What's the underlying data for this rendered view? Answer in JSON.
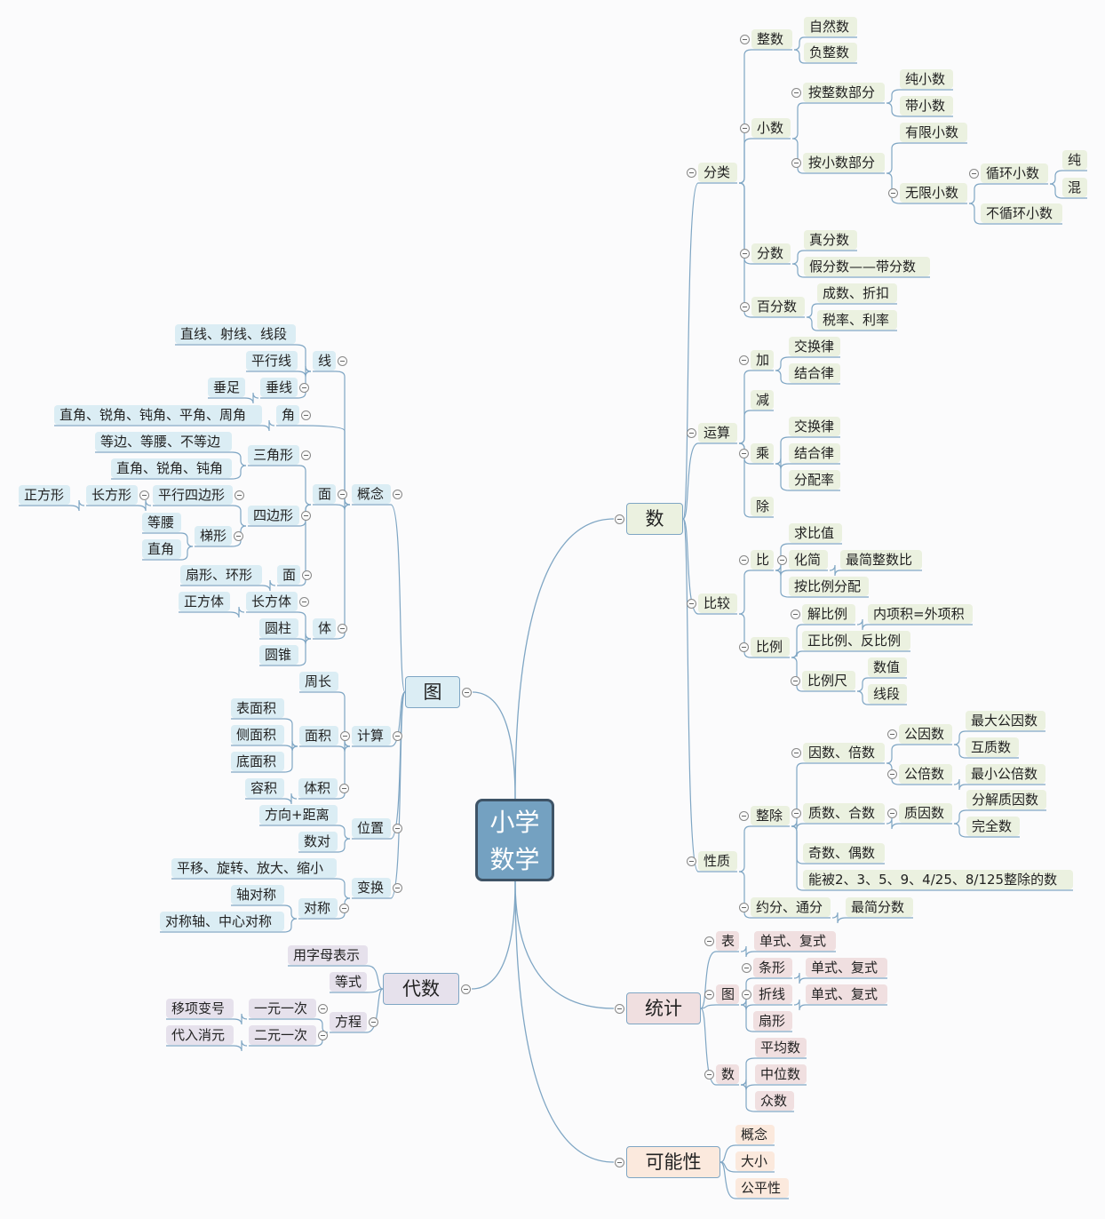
{
  "root": {
    "line1": "小学",
    "line2": "数学"
  },
  "colors": {
    "link": "#7fa6c4",
    "root_fill": "#74a1c1",
    "root_border": "#3e5366",
    "num": "#ebf1e0",
    "fig": "#dbedf4",
    "alg": "#e6e1ec",
    "sta": "#f0dfe0",
    "pro": "#fbe9dd"
  },
  "n": {
    "shu": "数",
    "fenlei": "分类",
    "zhengshu": "整数",
    "ziranshu": "自然数",
    "fuzhengshu": "负整数",
    "xiaoshu": "小数",
    "anzhengshu": "按整数部分",
    "chunxiaoshu": "纯小数",
    "daixiaoshu": "带小数",
    "anxiaoshu": "按小数部分",
    "youxian": "有限小数",
    "wuxian": "无限小数",
    "xunhuan": "循环小数",
    "chun": "纯",
    "hun": "混",
    "buxunhuan": "不循环小数",
    "fenshu": "分数",
    "zhenfenshu": "真分数",
    "jiafenshu": "假分数——带分数",
    "baifenshu": "百分数",
    "chengshu": "成数、折扣",
    "shuilv": "税率、利率",
    "yunsuan": "运算",
    "jia": "加",
    "jia_jh": "交换律",
    "jia_jh2": "结合律",
    "jian": "减",
    "cheng": "乘",
    "cheng_jh": "交换律",
    "cheng_jh2": "结合律",
    "fenpei": "分配率",
    "chu": "除",
    "bijiao": "比较",
    "bi": "比",
    "qiubizhi": "求比值",
    "huajian": "化简",
    "zuijianzhengshubi": "最简整数比",
    "anbili": "按比例分配",
    "bili": "比例",
    "jiebili": "解比例",
    "neixiang": "内项积=外项积",
    "zhengfan": "正比例、反比例",
    "bilichi": "比例尺",
    "shuzhi": "数值",
    "xianduan": "线段",
    "xingzhi": "性质",
    "zhengchu": "整除",
    "yinshu": "因数、倍数",
    "gongyin": "公因数",
    "zuidagongyin": "最大公因数",
    "huzhi": "互质数",
    "gongbei": "公倍数",
    "zuixiaogongbei": "最小公倍数",
    "zhishu": "质数、合数",
    "zhiyinshu": "质因数",
    "fenjie": "分解质因数",
    "wanquan": "完全数",
    "jiou": "奇数、偶数",
    "nengbei": "能被2、3、5、9、4/25、8/125整除的数",
    "yuefen": "约分、通分",
    "zuijianfenshu": "最简分数",
    "tongji": "统计",
    "biao": "表",
    "biao_d": "单式、复式",
    "tu2": "图",
    "tiaoxing": "条形",
    "tiao_d": "单式、复式",
    "zhexian": "折线",
    "zhe_d": "单式、复式",
    "shanxing": "扇形",
    "shu2": "数",
    "pingjun": "平均数",
    "zhongwei": "中位数",
    "zhongshu": "众数",
    "keneng": "可能性",
    "gainian2": "概念",
    "daxiao": "大小",
    "gongping": "公平性",
    "tu": "图",
    "gainian": "概念",
    "xian": "线",
    "zhixian": "直线、射线、线段",
    "pingxing": "平行线",
    "chuixian": "垂线",
    "chuizu": "垂足",
    "jiao": "角",
    "jiaos": "直角、锐角、钝角、平角、周角",
    "mian": "面",
    "sanjiao": "三角形",
    "dengbian": "等边、等腰、不等边",
    "zhijiao3": "直角、锐角、钝角",
    "sibian": "四边形",
    "pingxingsibian": "平行四边形",
    "changfang": "长方形",
    "zhengfang": "正方形",
    "tixing": "梯形",
    "dengyao": "等腰",
    "zhijiao": "直角",
    "mian2": "面",
    "shanhuan": "扇形、环形",
    "ti": "体",
    "changfangti": "长方体",
    "zhengfangti": "正方体",
    "yuanzhu": "圆柱",
    "yuanzhui": "圆锥",
    "jisuan": "计算",
    "zhouchang": "周长",
    "mianji": "面积",
    "biaomianji": "表面积",
    "cemianji": "侧面积",
    "dimianji": "底面积",
    "tiji": "体积",
    "rongji": "容积",
    "weizhi": "位置",
    "fangxiang": "方向+距离",
    "shudui": "数对",
    "bianhuan": "变换",
    "pingyi": "平移、旋转、放大、缩小",
    "duicheng": "对称",
    "zhouduicheng": "轴对称",
    "duichengzhou": "对称轴、中心对称",
    "daishu": "代数",
    "yongzimu": "用字母表示",
    "dengshi": "等式",
    "fangcheng": "方程",
    "yiyuan": "一元一次",
    "yixiang": "移项变号",
    "eryuan": "二元一次",
    "dairu": "代入消元"
  }
}
